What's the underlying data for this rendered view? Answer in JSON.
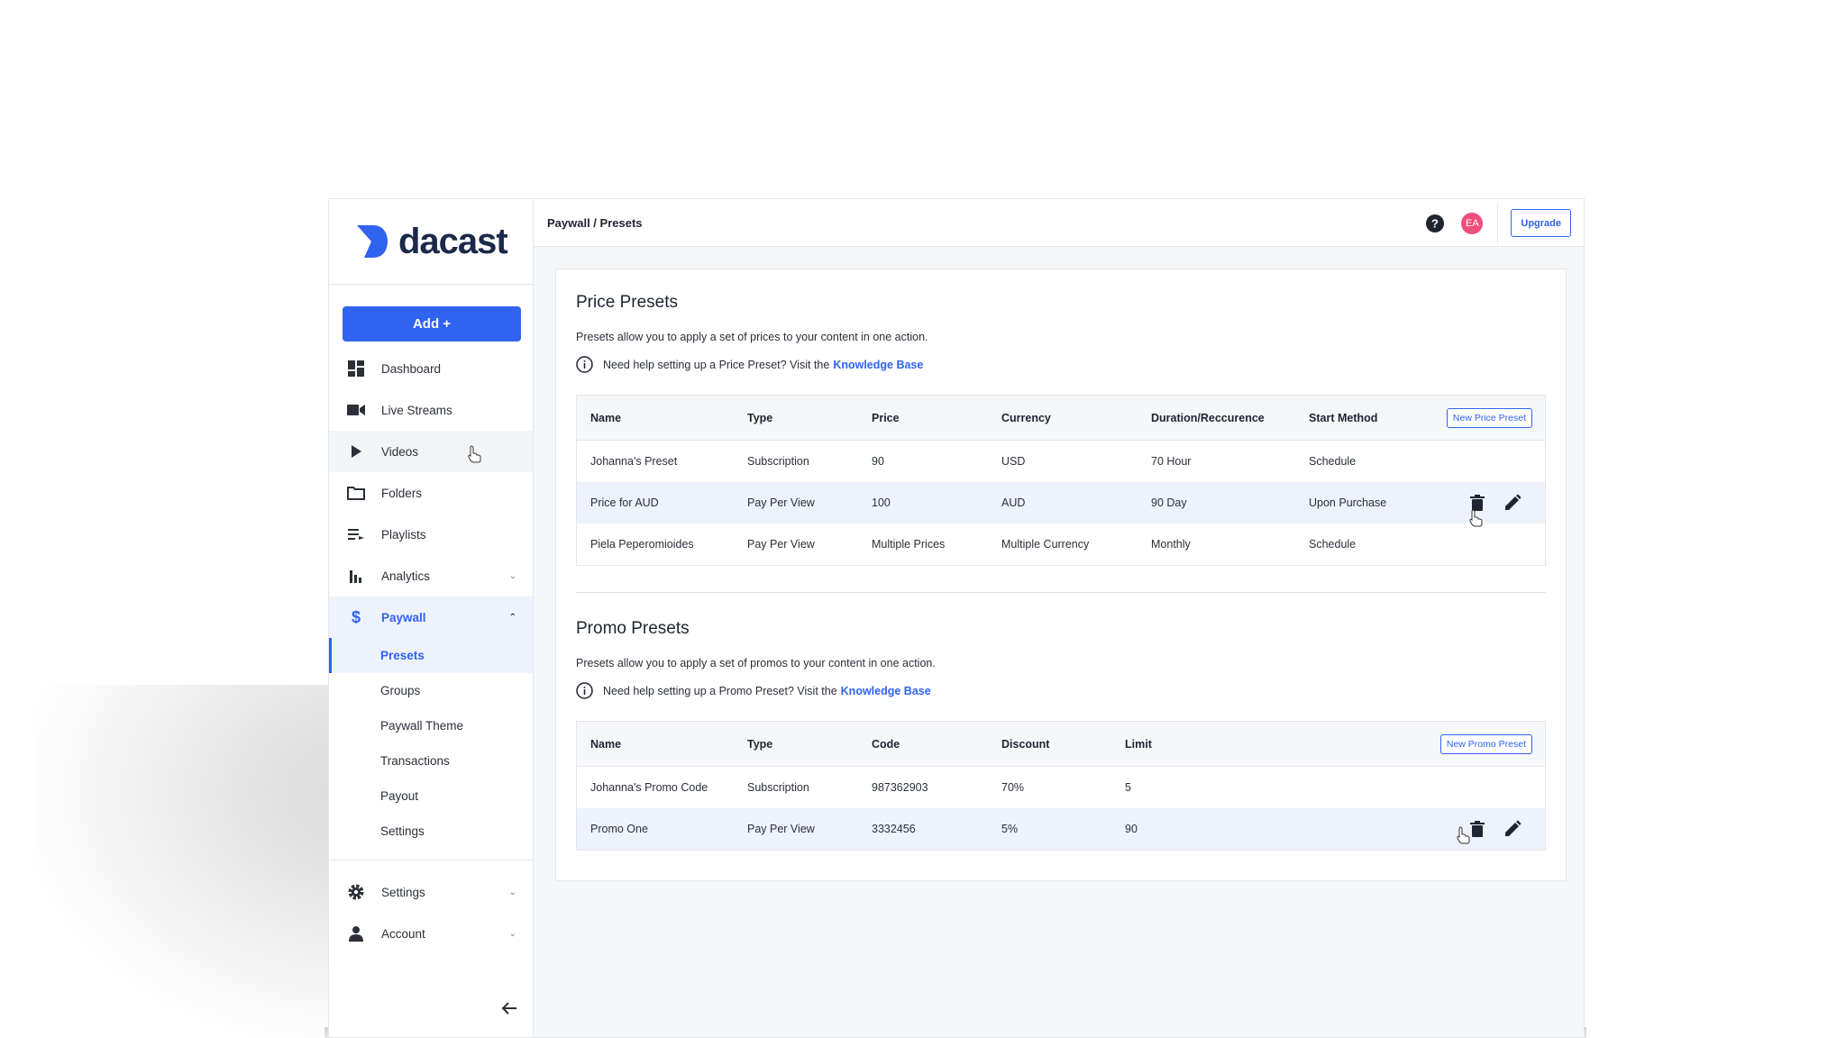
{
  "app": {
    "logo_text": "dacast"
  },
  "sidebar": {
    "add_label": "Add +",
    "items": [
      {
        "label": "Dashboard",
        "icon": "dashboard-icon"
      },
      {
        "label": "Live Streams",
        "icon": "video-camera-icon"
      },
      {
        "label": "Videos",
        "icon": "play-icon"
      },
      {
        "label": "Folders",
        "icon": "folder-icon"
      },
      {
        "label": "Playlists",
        "icon": "playlist-icon"
      },
      {
        "label": "Analytics",
        "icon": "bar-chart-icon"
      },
      {
        "label": "Paywall",
        "icon": "dollar-icon"
      }
    ],
    "paywall_sub": [
      "Presets",
      "Groups",
      "Paywall Theme",
      "Transactions",
      "Payout",
      "Settings"
    ],
    "bottom_items": [
      {
        "label": "Settings",
        "icon": "gear-icon"
      },
      {
        "label": "Account",
        "icon": "person-icon"
      }
    ]
  },
  "header": {
    "breadcrumb": "Paywall / Presets",
    "avatar_initials": "EA",
    "upgrade_label": "Upgrade"
  },
  "price_presets": {
    "title": "Price Presets",
    "description": "Presets allow you to apply a set of prices to your content in one action.",
    "help_text": "Need help setting up a Price Preset? Visit the",
    "help_link": "Knowledge Base",
    "new_button": "New Price Preset",
    "columns": [
      "Name",
      "Type",
      "Price",
      "Currency",
      "Duration/Reccurence",
      "Start Method"
    ],
    "rows": [
      [
        "Johanna's Preset",
        "Subscription",
        "90",
        "USD",
        "70 Hour",
        "Schedule"
      ],
      [
        "Price for AUD",
        "Pay Per View",
        "100",
        "AUD",
        "90 Day",
        "Upon Purchase"
      ],
      [
        "Piela Peperomioides",
        "Pay Per View",
        "Multiple Prices",
        "Multiple Currency",
        "Monthly",
        "Schedule"
      ]
    ]
  },
  "promo_presets": {
    "title": "Promo Presets",
    "description": "Presets allow you to apply a set of promos to your content in one action.",
    "help_text": "Need help setting up a Promo Preset? Visit the",
    "help_link": "Knowledge Base",
    "new_button": "New Promo Preset",
    "columns": [
      "Name",
      "Type",
      "Code",
      "Discount",
      "Limit"
    ],
    "rows": [
      [
        "Johanna's Promo Code",
        "Subscription",
        "987362903",
        "70%",
        "5"
      ],
      [
        "Promo One",
        "Pay Per View",
        "3332456",
        "5%",
        "90"
      ]
    ]
  },
  "colors": {
    "accent": "#2f63f0",
    "avatar": "#ef4e7b",
    "highlight_row": "#eef2fc"
  }
}
